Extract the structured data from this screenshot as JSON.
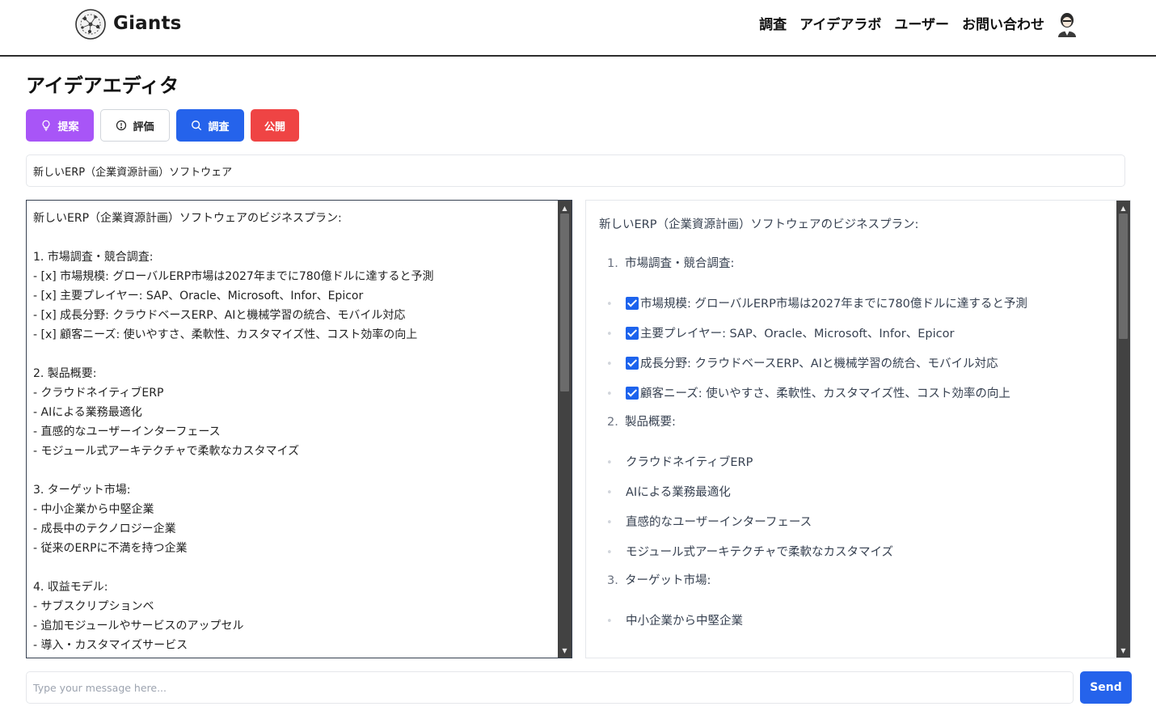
{
  "header": {
    "brand": "Giants",
    "nav": [
      "調査",
      "アイデアラボ",
      "ユーザー",
      "お問い合わせ"
    ]
  },
  "page": {
    "title": "アイデアエディタ"
  },
  "toolbar": {
    "suggest_label": "提案",
    "evaluate_label": "評価",
    "research_label": "調査",
    "publish_label": "公開"
  },
  "idea_title": {
    "value": "新しいERP（企業資源計画）ソフトウェア"
  },
  "editor": {
    "lines": [
      "新しいERP（企業資源計画）ソフトウェアのビジネスプラン:",
      "",
      "1. 市場調査・競合調査:",
      "- [x] 市場規模: グローバルERP市場は2027年までに780億ドルに達すると予測",
      "- [x] 主要プレイヤー: SAP、Oracle、Microsoft、Infor、Epicor",
      "- [x] 成長分野: クラウドベースERP、AIと機械学習の統合、モバイル対応",
      "- [x] 顧客ニーズ: 使いやすさ、柔軟性、カスタマイズ性、コスト効率の向上",
      "",
      "2. 製品概要:",
      "- クラウドネイティブERP",
      "- AIによる業務最適化",
      "- 直感的なユーザーインターフェース",
      "- モジュール式アーキテクチャで柔軟なカスタマイズ",
      "",
      "3. ターゲット市場:",
      "- 中小企業から中堅企業",
      "- 成長中のテクノロジー企業",
      "- 従来のERPに不満を持つ企業",
      "",
      "4. 収益モデル:",
      "- サブスクリプションベ",
      "- 追加モジュールやサービスのアップセル",
      "- 導入・カスタマイズサービス"
    ]
  },
  "preview": {
    "intro": "新しいERP（企業資源計画）ソフトウェアのビジネスプラン:",
    "sections": [
      {
        "num": "1.",
        "title": "市場調査・競合調査:",
        "items": [
          {
            "checked": true,
            "text": "市場規模: グローバルERP市場は2027年までに780億ドルに達すると予測"
          },
          {
            "checked": true,
            "text": "主要プレイヤー: SAP、Oracle、Microsoft、Infor、Epicor"
          },
          {
            "checked": true,
            "text": "成長分野: クラウドベースERP、AIと機械学習の統合、モバイル対応"
          },
          {
            "checked": true,
            "text": "顧客ニーズ: 使いやすさ、柔軟性、カスタマイズ性、コスト効率の向上"
          }
        ]
      },
      {
        "num": "2.",
        "title": "製品概要:",
        "items": [
          {
            "checked": false,
            "text": "クラウドネイティブERP"
          },
          {
            "checked": false,
            "text": "AIによる業務最適化"
          },
          {
            "checked": false,
            "text": "直感的なユーザーインターフェース"
          },
          {
            "checked": false,
            "text": "モジュール式アーキテクチャで柔軟なカスタマイズ"
          }
        ]
      },
      {
        "num": "3.",
        "title": "ターゲット市場:",
        "items": [
          {
            "checked": false,
            "text": "中小企業から中堅企業"
          }
        ]
      }
    ]
  },
  "chat": {
    "placeholder": "Type your message here...",
    "send_label": "Send"
  },
  "colors": {
    "suggest": "#a855f7",
    "research": "#2563eb",
    "publish": "#ef4444",
    "checkbox": "#1d63ed"
  }
}
